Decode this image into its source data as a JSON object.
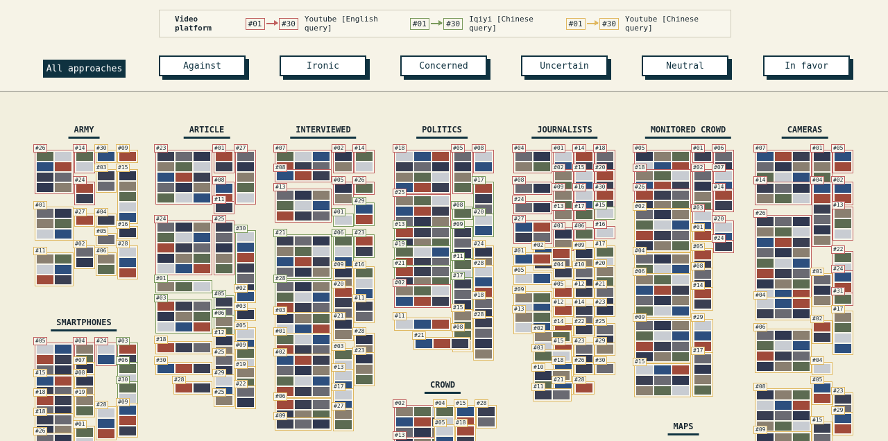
{
  "legend": {
    "title": "Video platform",
    "items": [
      {
        "from": "#01",
        "to": "#30",
        "label": "Youtube [English query]",
        "color": "#c0605f"
      },
      {
        "from": "#01",
        "to": "#30",
        "label": "Iqiyi [Chinese query]",
        "color": "#7a9a5c"
      },
      {
        "from": "#01",
        "to": "#30",
        "label": "Youtube [Chinese query]",
        "color": "#e0b860"
      }
    ]
  },
  "filters": {
    "all": "All approaches",
    "buttons": [
      "Against",
      "Ironic",
      "Concerned",
      "Uncertain",
      "Neutral",
      "In favor"
    ]
  },
  "categories": [
    "ARMY",
    "ARTICLE",
    "INTERVIEWED",
    "POLITICS",
    "JOURNALISTS",
    "MONITORED CROWD",
    "CAMERAS",
    "SMARTPHONES",
    "CROWD",
    "MAPS"
  ],
  "groups": [
    {
      "tag": "#26",
      "color": "red"
    },
    {
      "tag": "#14",
      "color": "red"
    },
    {
      "tag": "#30",
      "color": "yel"
    },
    {
      "tag": "#09",
      "color": "yel"
    },
    {
      "tag": "#03",
      "color": "yel"
    },
    {
      "tag": "#15",
      "color": "yel"
    },
    {
      "tag": "#24",
      "color": "red"
    },
    {
      "tag": "#01",
      "color": "yel"
    },
    {
      "tag": "#27",
      "color": "yel"
    },
    {
      "tag": "#04",
      "color": "yel"
    },
    {
      "tag": "#05",
      "color": "yel"
    },
    {
      "tag": "#16",
      "color": "yel"
    },
    {
      "tag": "#11",
      "color": "yel"
    },
    {
      "tag": "#02",
      "color": "yel"
    },
    {
      "tag": "#06",
      "color": "yel"
    },
    {
      "tag": "#28",
      "color": "yel"
    },
    {
      "tag": "#23",
      "color": "red"
    },
    {
      "tag": "#01",
      "color": "red"
    },
    {
      "tag": "#27",
      "color": "red"
    },
    {
      "tag": "#08",
      "color": "red"
    },
    {
      "tag": "#11",
      "color": "red"
    },
    {
      "tag": "#24",
      "color": "red"
    },
    {
      "tag": "#25",
      "color": "red"
    },
    {
      "tag": "#30",
      "color": "grn"
    },
    {
      "tag": "#01",
      "color": "grn"
    },
    {
      "tag": "#02",
      "color": "yel"
    },
    {
      "tag": "#03",
      "color": "grn"
    },
    {
      "tag": "#05",
      "color": "grn"
    },
    {
      "tag": "#03",
      "color": "yel"
    },
    {
      "tag": "#06",
      "color": "grn"
    },
    {
      "tag": "#05",
      "color": "yel"
    },
    {
      "tag": "#18",
      "color": "yel"
    },
    {
      "tag": "#12",
      "color": "yel"
    },
    {
      "tag": "#09",
      "color": "yel"
    },
    {
      "tag": "#30",
      "color": "yel"
    },
    {
      "tag": "#25",
      "color": "yel"
    },
    {
      "tag": "#19",
      "color": "yel"
    },
    {
      "tag": "#29",
      "color": "yel"
    },
    {
      "tag": "#28",
      "color": "yel"
    },
    {
      "tag": "#22",
      "color": "yel"
    },
    {
      "tag": "#25",
      "color": "yel"
    },
    {
      "tag": "#07",
      "color": "red"
    },
    {
      "tag": "#02",
      "color": "red"
    },
    {
      "tag": "#14",
      "color": "red"
    },
    {
      "tag": "#08",
      "color": "red"
    },
    {
      "tag": "#13",
      "color": "red"
    },
    {
      "tag": "#05",
      "color": "red"
    },
    {
      "tag": "#26",
      "color": "red"
    },
    {
      "tag": "#01",
      "color": "grn"
    },
    {
      "tag": "#29",
      "color": "grn"
    },
    {
      "tag": "#21",
      "color": "grn"
    },
    {
      "tag": "#06",
      "color": "grn"
    },
    {
      "tag": "#23",
      "color": "grn"
    },
    {
      "tag": "#28",
      "color": "grn"
    },
    {
      "tag": "#09",
      "color": "yel"
    },
    {
      "tag": "#16",
      "color": "yel"
    },
    {
      "tag": "#20",
      "color": "yel"
    },
    {
      "tag": "#03",
      "color": "yel"
    },
    {
      "tag": "#11",
      "color": "yel"
    },
    {
      "tag": "#21",
      "color": "yel"
    },
    {
      "tag": "#01",
      "color": "yel"
    },
    {
      "tag": "#28",
      "color": "yel"
    },
    {
      "tag": "#03",
      "color": "yel"
    },
    {
      "tag": "#02",
      "color": "yel"
    },
    {
      "tag": "#23",
      "color": "yel"
    },
    {
      "tag": "#13",
      "color": "yel"
    },
    {
      "tag": "#06",
      "color": "yel"
    },
    {
      "tag": "#17",
      "color": "yel"
    },
    {
      "tag": "#09",
      "color": "yel"
    },
    {
      "tag": "#27",
      "color": "yel"
    },
    {
      "tag": "#18",
      "color": "red"
    },
    {
      "tag": "#05",
      "color": "red"
    },
    {
      "tag": "#08",
      "color": "red"
    },
    {
      "tag": "#17",
      "color": "grn"
    },
    {
      "tag": "#25",
      "color": "red"
    },
    {
      "tag": "#08",
      "color": "grn"
    },
    {
      "tag": "#20",
      "color": "grn"
    },
    {
      "tag": "#13",
      "color": "grn"
    },
    {
      "tag": "#09",
      "color": "grn"
    },
    {
      "tag": "#19",
      "color": "grn"
    },
    {
      "tag": "#24",
      "color": "yel"
    },
    {
      "tag": "#11",
      "color": "grn"
    },
    {
      "tag": "#21",
      "color": "grn"
    },
    {
      "tag": "#28",
      "color": "yel"
    },
    {
      "tag": "#17",
      "color": "grn"
    },
    {
      "tag": "#02",
      "color": "red"
    },
    {
      "tag": "#18",
      "color": "yel"
    },
    {
      "tag": "#15",
      "color": "yel"
    },
    {
      "tag": "#11",
      "color": "yel"
    },
    {
      "tag": "#28",
      "color": "yel"
    },
    {
      "tag": "#08",
      "color": "yel"
    },
    {
      "tag": "#21",
      "color": "yel"
    },
    {
      "tag": "#04",
      "color": "red"
    },
    {
      "tag": "#01",
      "color": "red"
    },
    {
      "tag": "#14",
      "color": "red"
    },
    {
      "tag": "#18",
      "color": "red"
    },
    {
      "tag": "#02",
      "color": "red"
    },
    {
      "tag": "#15",
      "color": "red"
    },
    {
      "tag": "#20",
      "color": "red"
    },
    {
      "tag": "#08",
      "color": "red"
    },
    {
      "tag": "#09",
      "color": "red"
    },
    {
      "tag": "#16",
      "color": "red"
    },
    {
      "tag": "#30",
      "color": "red"
    },
    {
      "tag": "#24",
      "color": "red"
    },
    {
      "tag": "#13",
      "color": "red"
    },
    {
      "tag": "#17",
      "color": "red"
    },
    {
      "tag": "#15",
      "color": "grn"
    },
    {
      "tag": "#27",
      "color": "red"
    },
    {
      "tag": "#01",
      "color": "red"
    },
    {
      "tag": "#06",
      "color": "red"
    },
    {
      "tag": "#16",
      "color": "red"
    },
    {
      "tag": "#02",
      "color": "yel"
    },
    {
      "tag": "#09",
      "color": "yel"
    },
    {
      "tag": "#17",
      "color": "yel"
    },
    {
      "tag": "#01",
      "color": "yel"
    },
    {
      "tag": "#04",
      "color": "yel"
    },
    {
      "tag": "#10",
      "color": "yel"
    },
    {
      "tag": "#20",
      "color": "yel"
    },
    {
      "tag": "#05",
      "color": "yel"
    },
    {
      "tag": "#05",
      "color": "yel"
    },
    {
      "tag": "#12",
      "color": "yel"
    },
    {
      "tag": "#21",
      "color": "yel"
    },
    {
      "tag": "#09",
      "color": "yel"
    },
    {
      "tag": "#12",
      "color": "yel"
    },
    {
      "tag": "#14",
      "color": "yel"
    },
    {
      "tag": "#23",
      "color": "yel"
    },
    {
      "tag": "#13",
      "color": "yel"
    },
    {
      "tag": "#14",
      "color": "yel"
    },
    {
      "tag": "#22",
      "color": "yel"
    },
    {
      "tag": "#25",
      "color": "yel"
    },
    {
      "tag": "#02",
      "color": "yel"
    },
    {
      "tag": "#15",
      "color": "yel"
    },
    {
      "tag": "#23",
      "color": "yel"
    },
    {
      "tag": "#29",
      "color": "yel"
    },
    {
      "tag": "#03",
      "color": "yel"
    },
    {
      "tag": "#18",
      "color": "yel"
    },
    {
      "tag": "#26",
      "color": "yel"
    },
    {
      "tag": "#30",
      "color": "yel"
    },
    {
      "tag": "#10",
      "color": "yel"
    },
    {
      "tag": "#21",
      "color": "yel"
    },
    {
      "tag": "#28",
      "color": "yel"
    },
    {
      "tag": "#11",
      "color": "yel"
    },
    {
      "tag": "#05",
      "color": "red"
    },
    {
      "tag": "#01",
      "color": "red"
    },
    {
      "tag": "#06",
      "color": "red"
    },
    {
      "tag": "#18",
      "color": "red"
    },
    {
      "tag": "#02",
      "color": "red"
    },
    {
      "tag": "#07",
      "color": "red"
    },
    {
      "tag": "#26",
      "color": "red"
    },
    {
      "tag": "#03",
      "color": "red"
    },
    {
      "tag": "#14",
      "color": "red"
    },
    {
      "tag": "#02",
      "color": "yel"
    },
    {
      "tag": "#20",
      "color": "red"
    },
    {
      "tag": "#01",
      "color": "yel"
    },
    {
      "tag": "#24",
      "color": "red"
    },
    {
      "tag": "#04",
      "color": "yel"
    },
    {
      "tag": "#05",
      "color": "yel"
    },
    {
      "tag": "#08",
      "color": "yel"
    },
    {
      "tag": "#06",
      "color": "yel"
    },
    {
      "tag": "#14",
      "color": "yel"
    },
    {
      "tag": "#09",
      "color": "yel"
    },
    {
      "tag": "#29",
      "color": "yel"
    },
    {
      "tag": "#17",
      "color": "yel"
    },
    {
      "tag": "#15",
      "color": "yel"
    },
    {
      "tag": "#07",
      "color": "red"
    },
    {
      "tag": "#01",
      "color": "red"
    },
    {
      "tag": "#05",
      "color": "red"
    },
    {
      "tag": "#14",
      "color": "red"
    },
    {
      "tag": "#02",
      "color": "red"
    },
    {
      "tag": "#26",
      "color": "red"
    },
    {
      "tag": "#13",
      "color": "red"
    },
    {
      "tag": "#04",
      "color": "red"
    },
    {
      "tag": "#22",
      "color": "red"
    },
    {
      "tag": "#24",
      "color": "red"
    },
    {
      "tag": "#01",
      "color": "yel"
    },
    {
      "tag": "#31",
      "color": "red"
    },
    {
      "tag": "#04",
      "color": "yel"
    },
    {
      "tag": "#17",
      "color": "yel"
    },
    {
      "tag": "#02",
      "color": "yel"
    },
    {
      "tag": "#06",
      "color": "yel"
    },
    {
      "tag": "#04",
      "color": "yel"
    },
    {
      "tag": "#05",
      "color": "yel"
    },
    {
      "tag": "#23",
      "color": "yel"
    },
    {
      "tag": "#08",
      "color": "yel"
    },
    {
      "tag": "#29",
      "color": "yel"
    },
    {
      "tag": "#15",
      "color": "yel"
    },
    {
      "tag": "#09",
      "color": "yel"
    },
    {
      "tag": "#05",
      "color": "red"
    },
    {
      "tag": "#04",
      "color": "red"
    },
    {
      "tag": "#24",
      "color": "red"
    },
    {
      "tag": "#03",
      "color": "grn"
    },
    {
      "tag": "#07",
      "color": "yel"
    },
    {
      "tag": "#06",
      "color": "grn"
    },
    {
      "tag": "#15",
      "color": "yel"
    },
    {
      "tag": "#08",
      "color": "yel"
    },
    {
      "tag": "#30",
      "color": "grn"
    },
    {
      "tag": "#18",
      "color": "yel"
    },
    {
      "tag": "#19",
      "color": "yel"
    },
    {
      "tag": "#28",
      "color": "yel"
    },
    {
      "tag": "#18",
      "color": "yel"
    },
    {
      "tag": "#01",
      "color": "yel"
    },
    {
      "tag": "#09",
      "color": "yel"
    },
    {
      "tag": "#26",
      "color": "yel"
    },
    {
      "tag": "#02",
      "color": "red"
    },
    {
      "tag": "#04",
      "color": "yel"
    },
    {
      "tag": "#15",
      "color": "yel"
    },
    {
      "tag": "#28",
      "color": "yel"
    },
    {
      "tag": "#13",
      "color": "red"
    },
    {
      "tag": "#05",
      "color": "yel"
    },
    {
      "tag": "#18",
      "color": "yel"
    }
  ]
}
